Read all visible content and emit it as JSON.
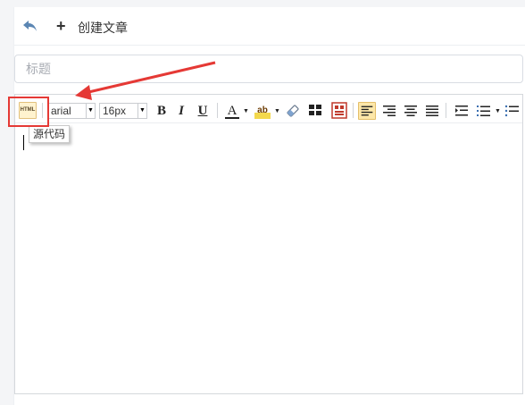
{
  "header": {
    "back_icon": "undo-arrow-icon",
    "plus_icon": "plus-icon",
    "title": "创建文章"
  },
  "title_field": {
    "placeholder": "标题",
    "value": ""
  },
  "toolbar": {
    "source_button_label": "HTML",
    "font_family": "arial",
    "font_size": "16px",
    "bold_label": "B",
    "italic_label": "I",
    "underline_label": "U",
    "font_color_label": "A",
    "highlight_label": "ab"
  },
  "tooltip": {
    "text": "源代码"
  },
  "colors": {
    "annotation": "#e53935",
    "active_button_bg": "#fde7a9"
  }
}
